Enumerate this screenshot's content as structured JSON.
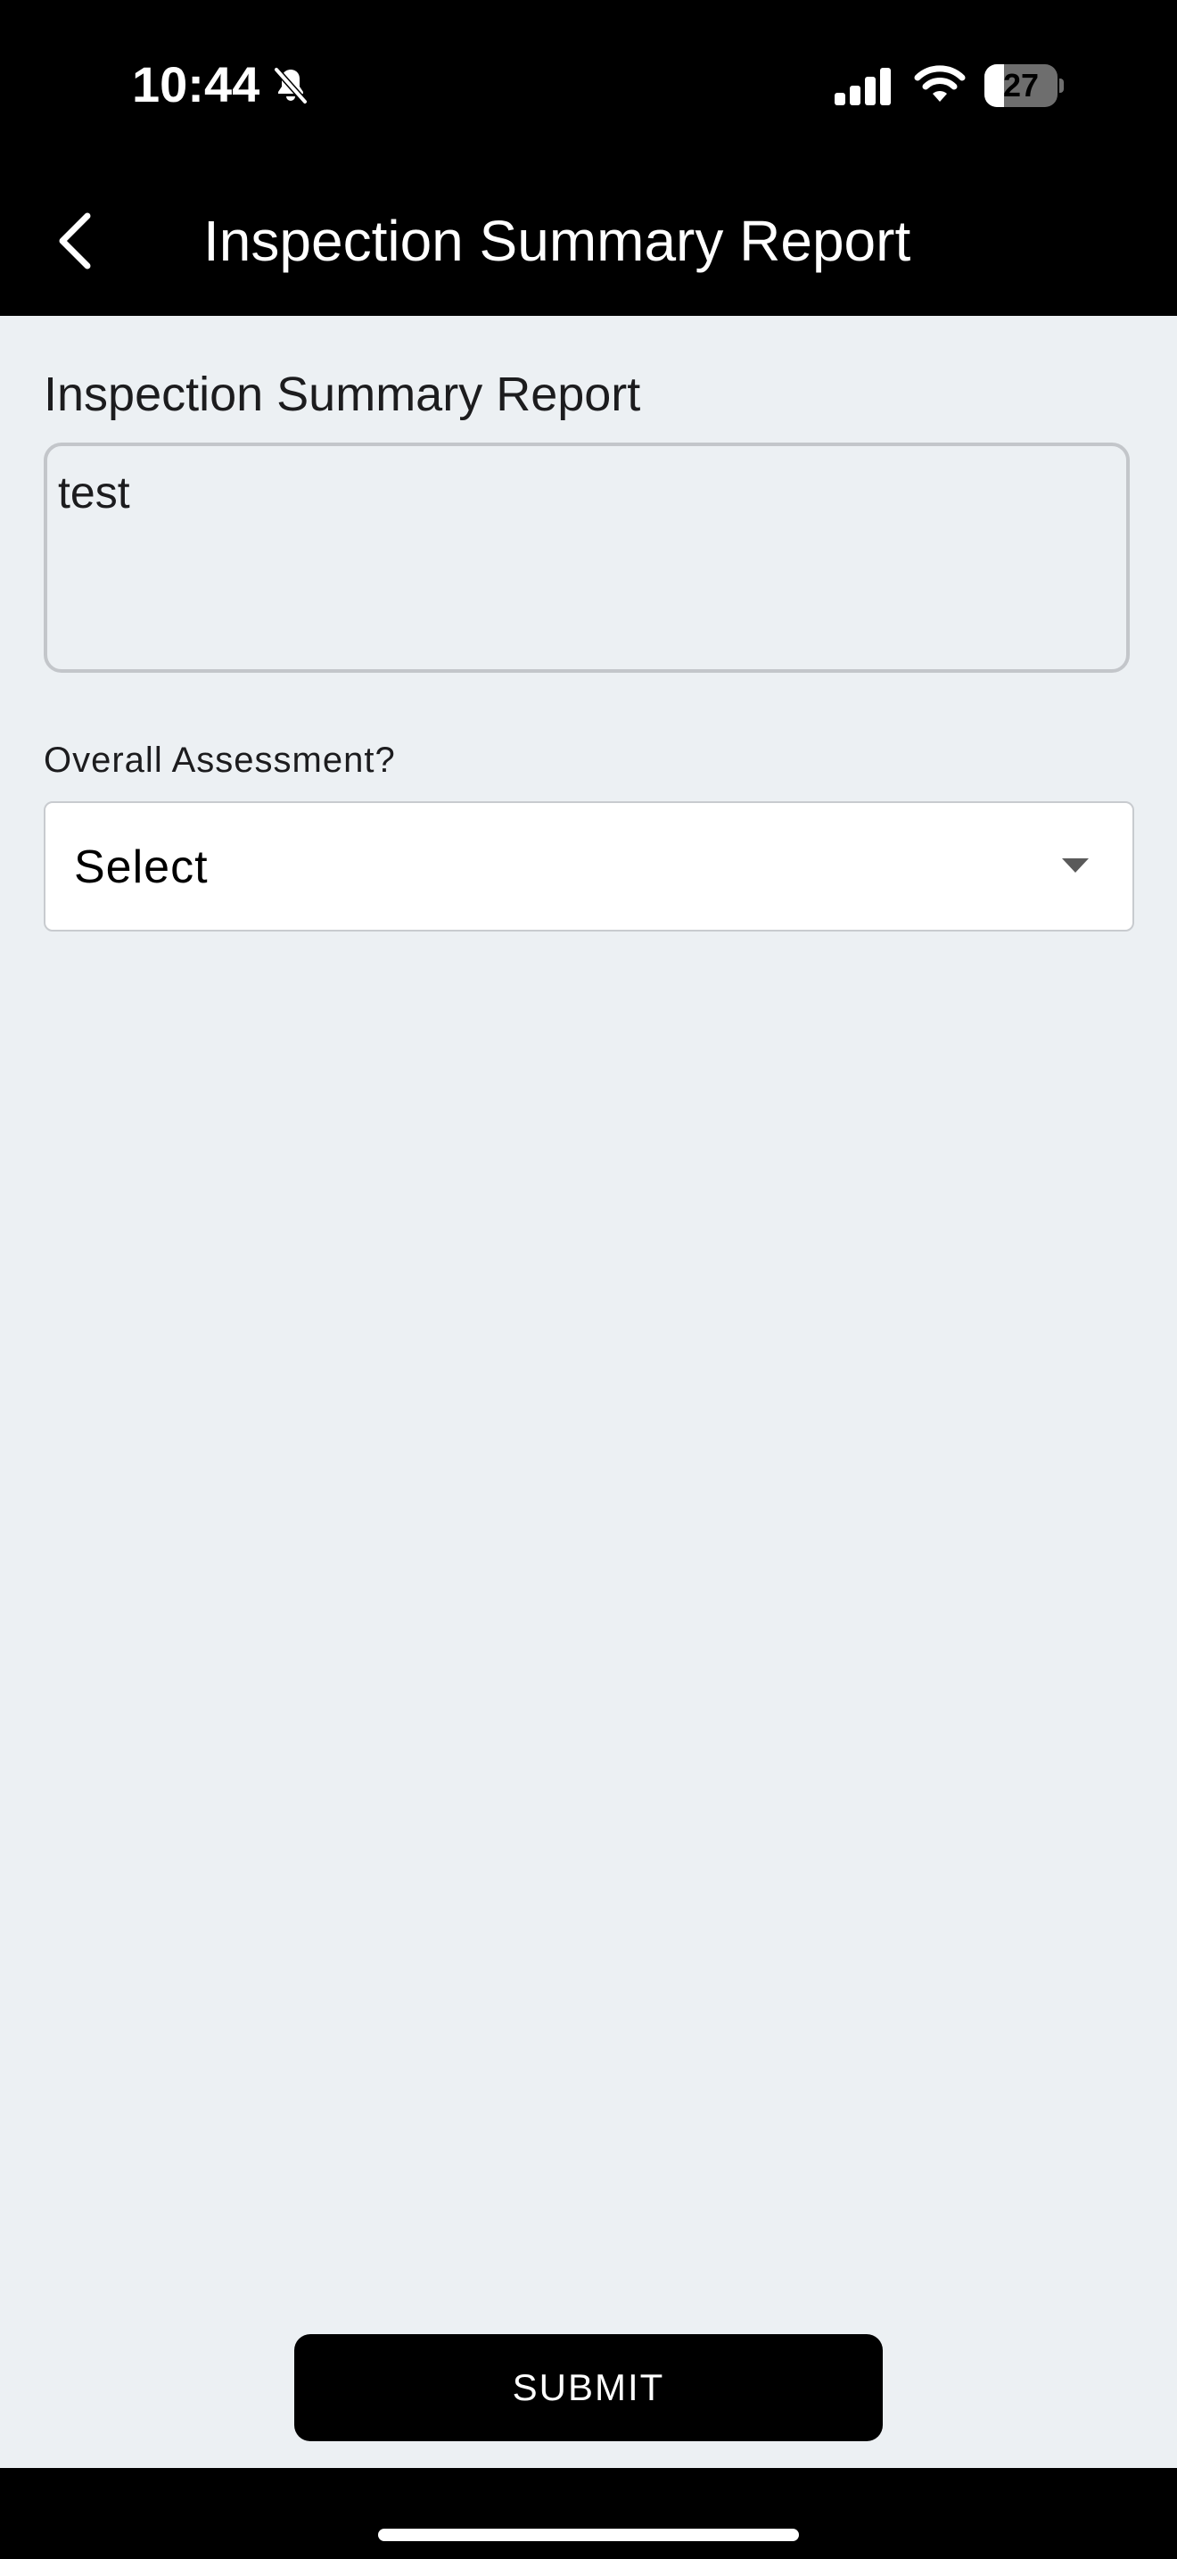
{
  "status_bar": {
    "time": "10:44",
    "battery_level": "27",
    "battery_fraction": 0.27,
    "icons": [
      "bell-off-icon",
      "signal-icon",
      "wifi-icon",
      "battery-icon"
    ]
  },
  "app_bar": {
    "title": "Inspection Summary Report",
    "back_icon": "chevron-left-icon"
  },
  "form": {
    "summary_field": {
      "label": "Inspection Summary Report",
      "value": "test"
    },
    "assessment_field": {
      "label": "Overall Assessment?",
      "selected": "Select",
      "icon": "caret-down-icon"
    }
  },
  "actions": {
    "submit_label": "SUBMIT"
  },
  "colors": {
    "header_bg": "#000000",
    "page_bg": "#ECF0F3",
    "button_bg": "#000000",
    "button_text": "#ffffff",
    "field_border": "#c3c6ca"
  }
}
